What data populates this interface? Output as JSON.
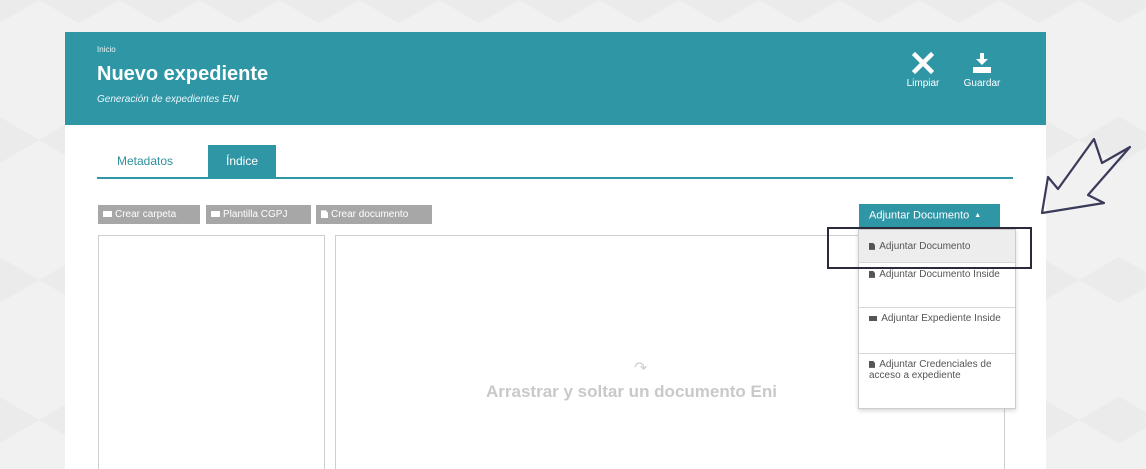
{
  "header": {
    "breadcrumb": "Inicio",
    "title": "Nuevo expediente",
    "subtitle": "Generación de expedientes ENI",
    "clear_label": "Limpiar",
    "save_label": "Guardar"
  },
  "tabs": [
    {
      "label": "Metadatos",
      "active": false
    },
    {
      "label": "Índice",
      "active": true
    }
  ],
  "toolbar": {
    "create_folder": "Crear carpeta",
    "template": "Plantilla CGPJ",
    "create_document": "Crear documento"
  },
  "attach": {
    "button_label": "Adjuntar Documento",
    "items": [
      {
        "label": "Adjuntar Documento",
        "icon": "document-icon"
      },
      {
        "label": "Adjuntar Documento Inside",
        "icon": "document-icon"
      },
      {
        "label": "Adjuntar Expediente Inside",
        "icon": "folder-icon"
      },
      {
        "label": "Adjuntar Credenciales de acceso a expediente",
        "icon": "document-icon"
      }
    ]
  },
  "dropzone": {
    "text": "Arrastrar y soltar un documento Eni"
  },
  "colors": {
    "accent": "#2f96a6",
    "toolbar_button": "#a7a7a7"
  }
}
